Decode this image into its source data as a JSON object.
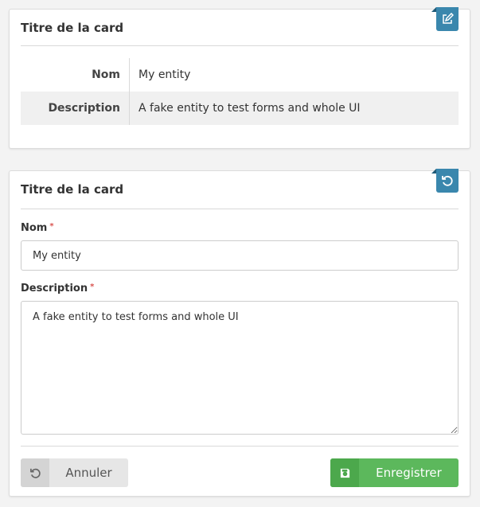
{
  "view_card": {
    "title": "Titre de la card",
    "edit_icon": "edit-icon",
    "rows": [
      {
        "key": "Nom",
        "value": "My entity"
      },
      {
        "key": "Description",
        "value": "A fake entity to test forms and whole UI"
      }
    ]
  },
  "form_card": {
    "title": "Titre de la card",
    "reset_icon": "undo-icon",
    "fields": {
      "nom": {
        "label": "Nom",
        "required": "*",
        "value": "My entity"
      },
      "description": {
        "label": "Description",
        "required": "*",
        "value": "A fake entity to test forms and whole UI"
      }
    },
    "buttons": {
      "cancel": {
        "label": "Annuler",
        "icon": "undo-icon"
      },
      "save": {
        "label": "Enregistrer",
        "icon": "save-icon"
      }
    }
  },
  "colors": {
    "accent": "#3a87ad",
    "success": "#5cb85c",
    "required": "#d9534f"
  }
}
